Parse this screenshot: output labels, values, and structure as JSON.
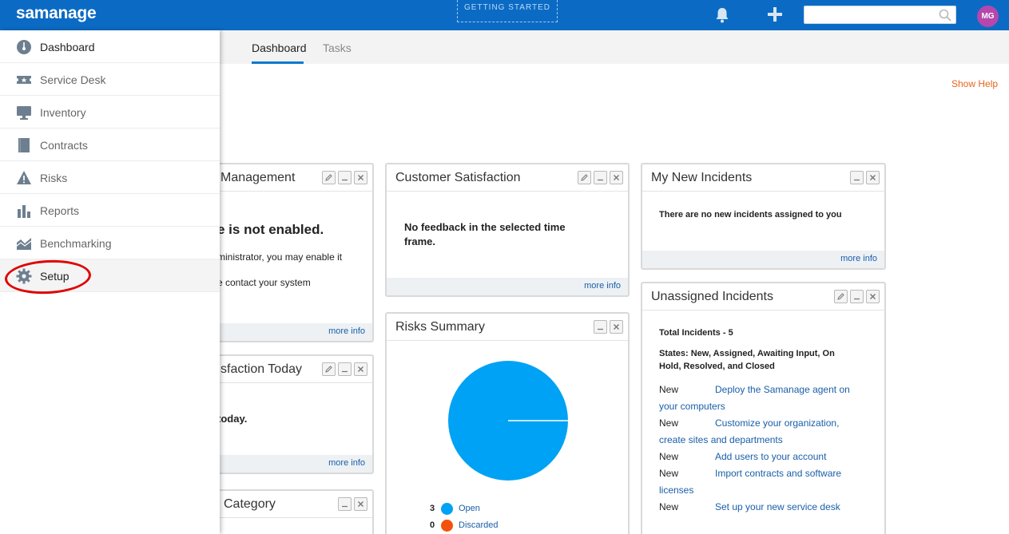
{
  "header": {
    "logo": "samanage",
    "getting_started": "GETTING STARTED",
    "search_placeholder": "",
    "avatar_initials": "MG",
    "brand_color": "#0b6bc4"
  },
  "tabs": [
    {
      "label": "Dashboard",
      "active": true
    },
    {
      "label": "Tasks",
      "active": false
    }
  ],
  "show_help": "Show Help",
  "sidebar": {
    "items": [
      {
        "label": "Dashboard",
        "icon": "dashboard-icon"
      },
      {
        "label": "Service Desk",
        "icon": "service-desk-icon"
      },
      {
        "label": "Inventory",
        "icon": "monitor-icon"
      },
      {
        "label": "Contracts",
        "icon": "document-icon"
      },
      {
        "label": "Risks",
        "icon": "warning-icon"
      },
      {
        "label": "Reports",
        "icon": "bar-chart-icon"
      },
      {
        "label": "Benchmarking",
        "icon": "benchmark-icon"
      },
      {
        "label": "Setup",
        "icon": "gear-icon"
      }
    ]
  },
  "widgets": {
    "management": {
      "title": "Management",
      "heading": "e is not enabled.",
      "line1": "ministrator, you may enable it",
      "line2": "e contact your system",
      "more_info": "more info"
    },
    "satisfaction_today": {
      "title": "sfaction Today",
      "body": "today.",
      "more_info": "more info"
    },
    "category": {
      "title": "Category"
    },
    "customer_satisfaction": {
      "title": "Customer Satisfaction",
      "body_line1": "No feedback in the selected time",
      "body_line2": "frame.",
      "more_info": "more info"
    },
    "risks_summary": {
      "title": "Risks Summary",
      "legend": [
        {
          "count": "3",
          "label": "Open",
          "color": "#00a2f5"
        },
        {
          "count": "0",
          "label": "Discarded",
          "color": "#f2520d"
        }
      ]
    },
    "my_new_incidents": {
      "title": "My New Incidents",
      "body": "There are no new incidents assigned to you",
      "more_info": "more info"
    },
    "unassigned_incidents": {
      "title": "Unassigned Incidents",
      "total": "Total Incidents - 5",
      "states_line1": "States: New, Assigned, Awaiting Input, On",
      "states_line2": "Hold, Resolved, and Closed",
      "rows": [
        {
          "status": "New",
          "line1": "Deploy the Samanage agent on",
          "line2": "your computers"
        },
        {
          "status": "New",
          "line1": "Customize your organization,",
          "line2": "create sites and departments"
        },
        {
          "status": "New",
          "line1": "Add users to your account",
          "line2": ""
        },
        {
          "status": "New",
          "line1": "Import contracts and software",
          "line2": "licenses"
        },
        {
          "status": "New",
          "line1": "Set up your new service desk",
          "line2": ""
        }
      ]
    }
  },
  "chart_data": {
    "type": "pie",
    "categories": [
      "Open",
      "Discarded"
    ],
    "values": [
      3,
      0
    ],
    "colors": [
      "#00a2f5",
      "#f2520d"
    ],
    "legend": "bottom"
  }
}
